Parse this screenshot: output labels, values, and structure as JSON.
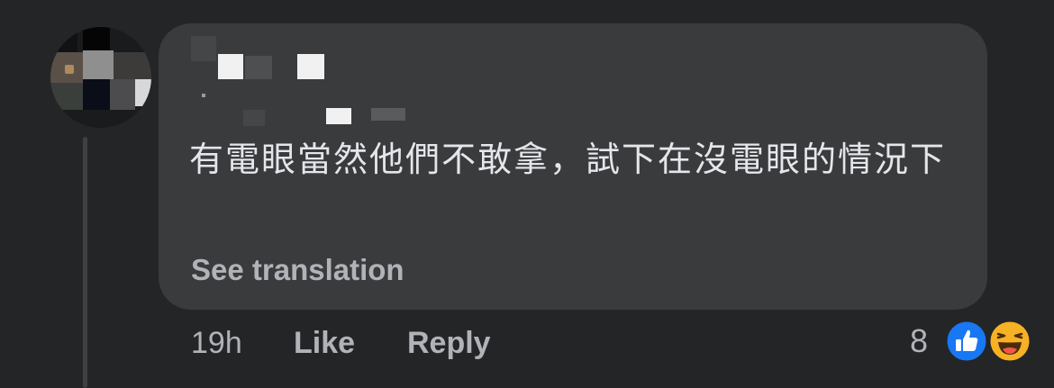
{
  "comment": {
    "text": "有電眼當然他們不敢拿，試下在沒電眼的情況下",
    "see_translation_label": "See translation"
  },
  "actions": {
    "timestamp": "19h",
    "like_label": "Like",
    "reply_label": "Reply"
  },
  "reactions": {
    "count": "8",
    "types": [
      "like-icon",
      "haha-icon"
    ]
  },
  "colors": {
    "background": "#242526",
    "bubble": "#3a3b3c",
    "primary_text": "#e4e6eb",
    "secondary_text": "#b0b3b8",
    "like_blue": "#1877f2",
    "haha_yellow": "#f7b125"
  }
}
